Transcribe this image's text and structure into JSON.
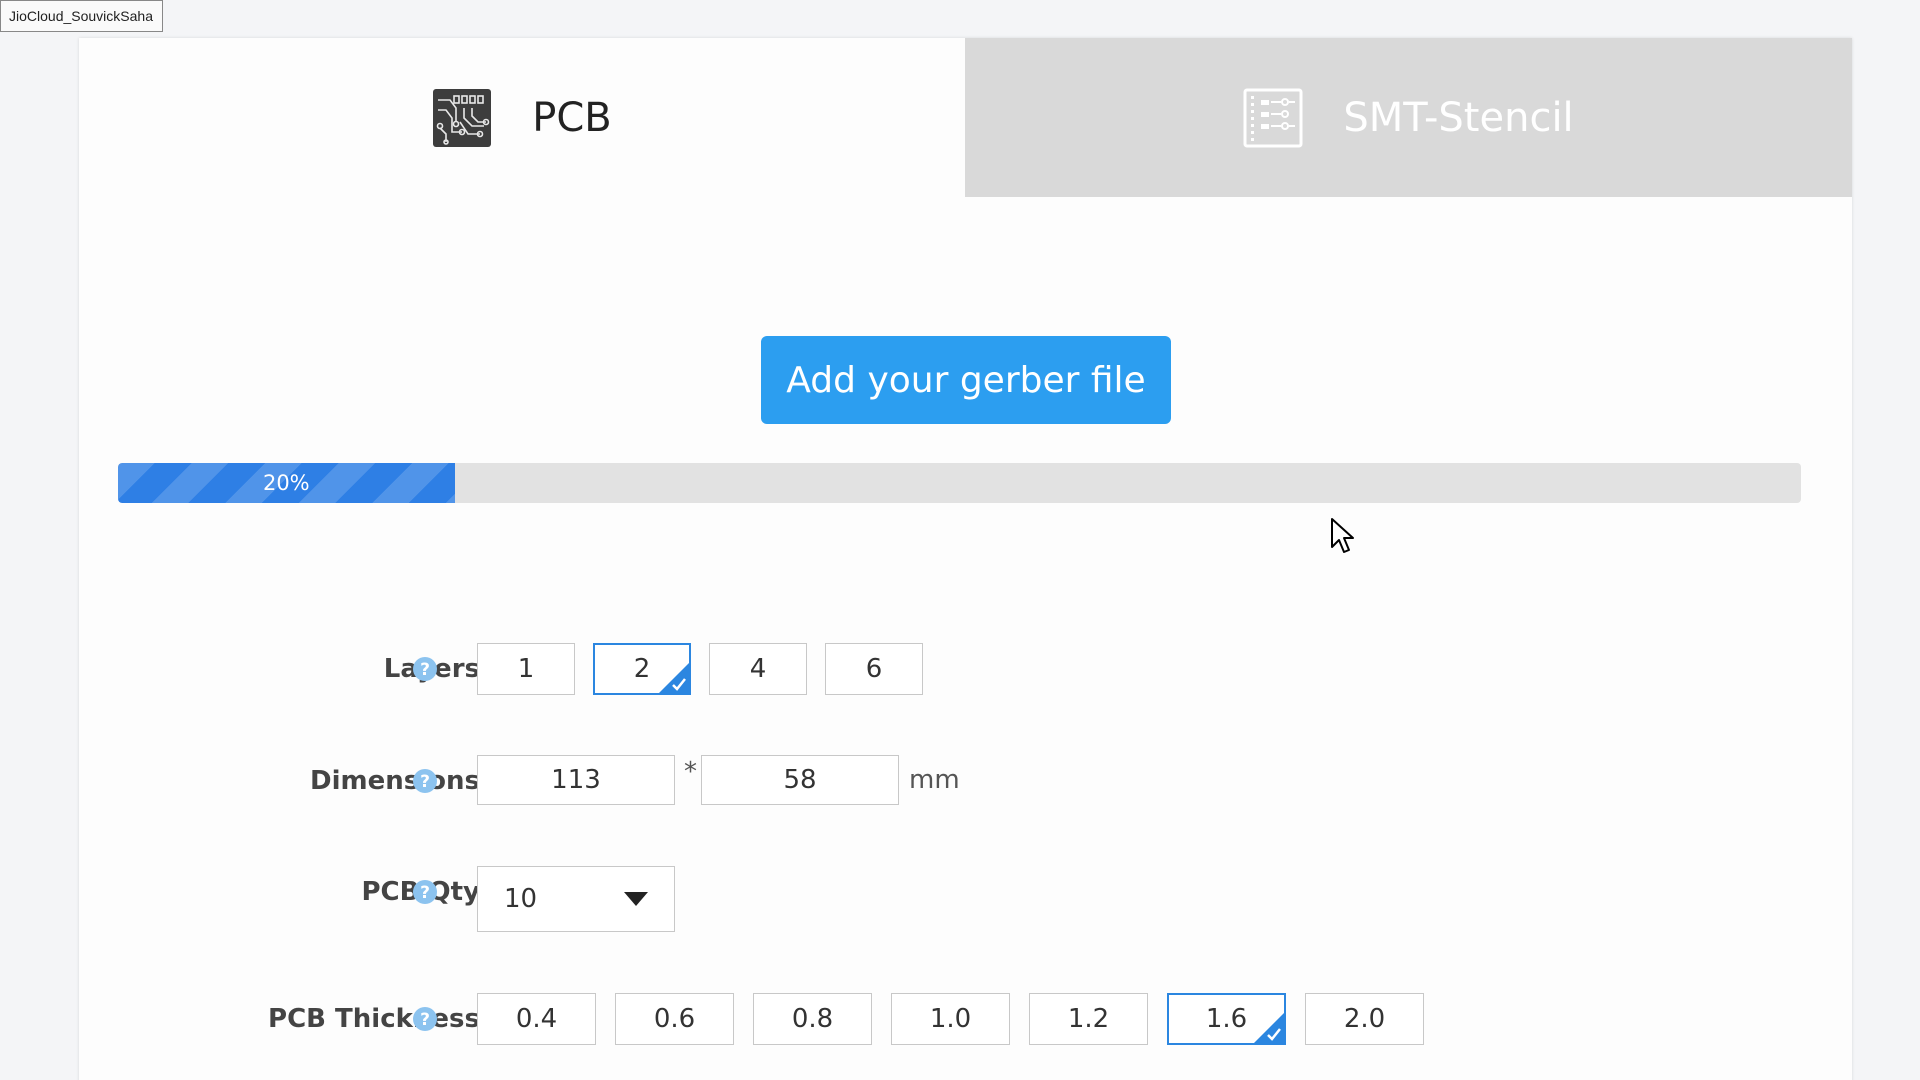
{
  "watermark": "JioCloud_SouvickSaha",
  "tabs": [
    {
      "label": "PCB",
      "icon": "pcb-board-icon",
      "active": true
    },
    {
      "label": "SMT-Stencil",
      "icon": "stencil-icon",
      "active": false
    }
  ],
  "upload": {
    "label": "Add your gerber file"
  },
  "progress": {
    "value": 0.2,
    "label": "20%"
  },
  "layers": {
    "label": "Layers",
    "options": [
      "1",
      "2",
      "4",
      "6"
    ],
    "selected": "2"
  },
  "dimensions": {
    "label": "Dimensions",
    "width": "113",
    "height": "58",
    "separator": "*",
    "unit": "mm"
  },
  "qty": {
    "label": "PCB Qty",
    "value": "10"
  },
  "thickness": {
    "label": "PCB Thickness",
    "options": [
      "0.4",
      "0.6",
      "0.8",
      "1.0",
      "1.2",
      "1.6",
      "2.0"
    ],
    "selected": "1.6"
  },
  "colors": {
    "accent": "#2c9ef0",
    "progress": "#2e7fe5",
    "inactive_tab": "#d9d9d9",
    "help": "#8cc3ef"
  }
}
